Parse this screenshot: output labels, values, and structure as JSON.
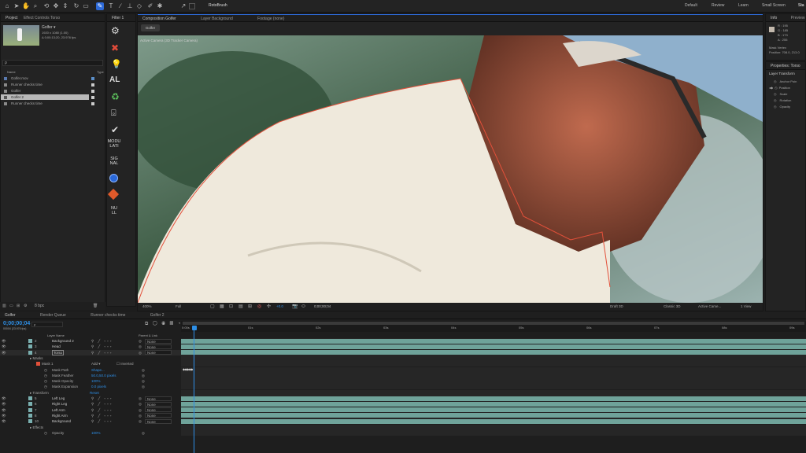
{
  "toolbar": {
    "tool_label": "RotoBrush",
    "workspaces": [
      "Default",
      "Review",
      "Learn",
      "Small Screen",
      "Sta"
    ]
  },
  "project": {
    "tabs": [
      "Project",
      "Effect Controls Torso"
    ],
    "item_name": "Golfer ▾",
    "item_info": [
      "1920 x 1080 (1.00)",
      "Δ 0;00;13;20, 23.976 fps"
    ],
    "search_placeholder": "ρ",
    "columns": [
      "Name",
      "Type"
    ],
    "items": [
      "Golfer.mov",
      "Runner checks time",
      "Golfer",
      "Golfer 2",
      "Runner checks time"
    ]
  },
  "filter_panel": {
    "title": "Filter 1",
    "labels": [
      "AL",
      "MODU\nLATI",
      "SIG\nNAL",
      "NU\nLL"
    ]
  },
  "composition": {
    "tabs": [
      "Composition Golfer",
      "Layer Background",
      "Footage (none)"
    ],
    "sub_tab": "Golfer",
    "camera_label": "Active Camera (3D Tracker Camera)",
    "zoom": "400%",
    "resolution": "Full",
    "timecode": "0;00;00;04",
    "renderer": "Draft 3D",
    "renderer_mode": "Classic 3D",
    "camera": "Active Came...",
    "view": "1 View"
  },
  "info": {
    "tabs": [
      "Info",
      "Preview"
    ],
    "values": [
      "R : 195",
      "G : 185",
      "B : 173",
      "A : 255"
    ],
    "details": [
      "Mask Vertex",
      "Position: 708.0, 213.0"
    ]
  },
  "properties": {
    "title": "Properties: Torso",
    "section": "Layer Transform",
    "items": [
      "Anchor Poin",
      "Position",
      "Scale",
      "Rotation",
      "Opacity"
    ]
  },
  "bottom_bar": {
    "bpc": "8 bpc"
  },
  "timeline": {
    "tabs": [
      "Golfer",
      "Render Queue",
      "Runner checks time",
      "Golfer 2"
    ],
    "current_time": "0;00;00;04",
    "fps_info": "00004 (23.976 fps)",
    "columns": [
      "Layer Name",
      "Parent & Link"
    ],
    "ruler": [
      "0:00s",
      "01s",
      "02s",
      "03s",
      "04s",
      "05s",
      "06s",
      "07s",
      "08s",
      "09s"
    ],
    "rows": [
      {
        "num": "2",
        "name": "Background 2",
        "parent": "None",
        "kind": "layer"
      },
      {
        "num": "3",
        "name": "Head",
        "parent": "None",
        "kind": "layer"
      },
      {
        "num": "4",
        "name": "Torso",
        "parent": "None",
        "kind": "layer"
      },
      {
        "name": "Masks",
        "kind": "group"
      },
      {
        "name": "Mask 1",
        "mode": "Add",
        "inverted": "Inverted",
        "kind": "mask"
      },
      {
        "name": "Mask Path",
        "value": "Shape...",
        "kind": "prop"
      },
      {
        "name": "Mask Feather",
        "value": "50.0,50.0 pixels",
        "kind": "prop"
      },
      {
        "name": "Mask Opacity",
        "value": "100%",
        "kind": "prop"
      },
      {
        "name": "Mask Expansion",
        "value": "0.0 pixels",
        "kind": "prop"
      },
      {
        "name": "Transform",
        "value": "Reset",
        "kind": "group"
      },
      {
        "num": "5",
        "name": "Left Leg",
        "parent": "None",
        "kind": "layer"
      },
      {
        "num": "6",
        "name": "Right Leg",
        "parent": "None",
        "kind": "layer"
      },
      {
        "num": "7",
        "name": "Left Arm",
        "parent": "None",
        "kind": "layer"
      },
      {
        "num": "8",
        "name": "Right Arm",
        "parent": "None",
        "kind": "layer"
      },
      {
        "num": "10",
        "name": "Background",
        "parent": "None",
        "kind": "layer"
      },
      {
        "name": "Effects",
        "kind": "group"
      },
      {
        "name": "Opacity",
        "value": "100%",
        "kind": "prop"
      }
    ]
  }
}
